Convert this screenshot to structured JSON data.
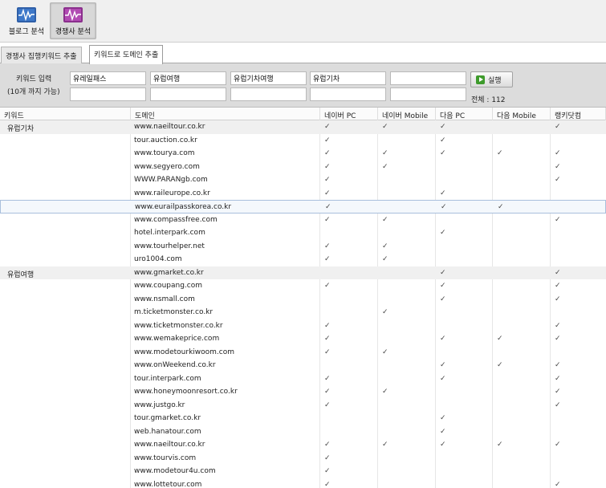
{
  "toolbar": {
    "blog_label": "블로그 분석",
    "competitor_label": "경쟁사 분석"
  },
  "tabs": [
    {
      "label": "경쟁사 집행키워드 추출"
    },
    {
      "label": "키워드로 도메인 추출"
    }
  ],
  "entry": {
    "label_line1": "키워드 입력",
    "label_line2": "(10개 까지 가능)",
    "keywords": [
      "유레일패스",
      "유럽여행",
      "유럽기차여행",
      "유럽기차",
      "",
      "",
      "",
      "",
      "",
      ""
    ],
    "run_label": "실행",
    "total_label": "전체 : 112"
  },
  "table": {
    "headers": [
      "키워드",
      "도메인",
      "네이버 PC",
      "네이버 Mobile",
      "다음 PC",
      "다음 Mobile",
      "랭키닷컴"
    ],
    "check_glyph": "✓",
    "rows": [
      {
        "keyword": "유럽기차",
        "domain": "www.naeiltour.co.kr",
        "checks": [
          1,
          1,
          1,
          0,
          1
        ]
      },
      {
        "keyword": "",
        "domain": "tour.auction.co.kr",
        "checks": [
          1,
          0,
          1,
          0,
          0
        ]
      },
      {
        "keyword": "",
        "domain": "www.tourya.com",
        "checks": [
          1,
          1,
          1,
          1,
          1
        ]
      },
      {
        "keyword": "",
        "domain": "www.segyero.com",
        "checks": [
          1,
          1,
          0,
          0,
          1
        ]
      },
      {
        "keyword": "",
        "domain": "WWW.PARANgb.com",
        "checks": [
          1,
          0,
          0,
          0,
          1
        ]
      },
      {
        "keyword": "",
        "domain": "www.raileurope.co.kr",
        "checks": [
          1,
          0,
          1,
          0,
          0
        ]
      },
      {
        "keyword": "",
        "domain": "www.eurailpasskorea.co.kr",
        "checks": [
          1,
          0,
          1,
          1,
          0
        ]
      },
      {
        "keyword": "",
        "domain": "www.compassfree.com",
        "checks": [
          1,
          1,
          0,
          0,
          1
        ]
      },
      {
        "keyword": "",
        "domain": "hotel.interpark.com",
        "checks": [
          0,
          0,
          1,
          0,
          0
        ]
      },
      {
        "keyword": "",
        "domain": "www.tourhelper.net",
        "checks": [
          1,
          1,
          0,
          0,
          0
        ]
      },
      {
        "keyword": "",
        "domain": "uro1004.com",
        "checks": [
          1,
          1,
          0,
          0,
          0
        ]
      },
      {
        "keyword": "유럽여행",
        "domain": "www.gmarket.co.kr",
        "checks": [
          0,
          0,
          1,
          0,
          1
        ]
      },
      {
        "keyword": "",
        "domain": "www.coupang.com",
        "checks": [
          1,
          0,
          1,
          0,
          1
        ]
      },
      {
        "keyword": "",
        "domain": "www.nsmall.com",
        "checks": [
          0,
          0,
          1,
          0,
          1
        ]
      },
      {
        "keyword": "",
        "domain": "m.ticketmonster.co.kr",
        "checks": [
          0,
          1,
          0,
          0,
          0
        ]
      },
      {
        "keyword": "",
        "domain": "www.ticketmonster.co.kr",
        "checks": [
          1,
          0,
          0,
          0,
          1
        ]
      },
      {
        "keyword": "",
        "domain": "www.wemakeprice.com",
        "checks": [
          1,
          0,
          1,
          1,
          1
        ]
      },
      {
        "keyword": "",
        "domain": "www.modetourkiwoom.com",
        "checks": [
          1,
          1,
          0,
          0,
          0
        ]
      },
      {
        "keyword": "",
        "domain": "www.onWeekend.co.kr",
        "checks": [
          0,
          0,
          1,
          1,
          1
        ]
      },
      {
        "keyword": "",
        "domain": "tour.interpark.com",
        "checks": [
          1,
          0,
          1,
          0,
          1
        ]
      },
      {
        "keyword": "",
        "domain": "www.honeymoonresort.co.kr",
        "checks": [
          1,
          1,
          0,
          0,
          1
        ]
      },
      {
        "keyword": "",
        "domain": "www.justgo.kr",
        "checks": [
          1,
          0,
          0,
          0,
          1
        ]
      },
      {
        "keyword": "",
        "domain": "tour.gmarket.co.kr",
        "checks": [
          0,
          0,
          1,
          0,
          0
        ]
      },
      {
        "keyword": "",
        "domain": "web.hanatour.com",
        "checks": [
          0,
          0,
          1,
          0,
          0
        ]
      },
      {
        "keyword": "",
        "domain": "www.naeiltour.co.kr",
        "checks": [
          1,
          1,
          1,
          1,
          1
        ]
      },
      {
        "keyword": "",
        "domain": "www.tourvis.com",
        "checks": [
          1,
          0,
          0,
          0,
          0
        ]
      },
      {
        "keyword": "",
        "domain": "www.modetour4u.com",
        "checks": [
          1,
          0,
          0,
          0,
          0
        ]
      },
      {
        "keyword": "",
        "domain": "www.lottetour.com",
        "checks": [
          1,
          0,
          0,
          0,
          1
        ]
      }
    ]
  }
}
